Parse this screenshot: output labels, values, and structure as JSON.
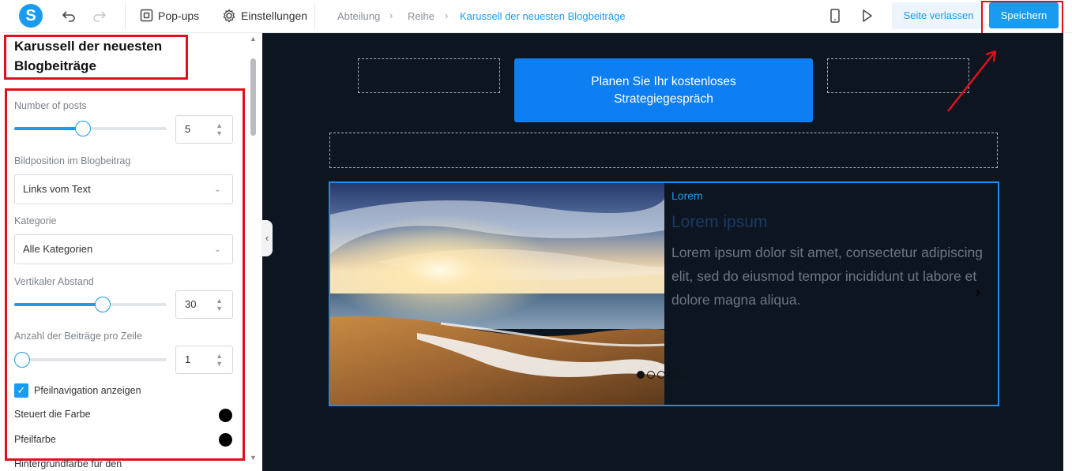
{
  "topbar": {
    "logo_letter": "S",
    "popups_label": "Pop-ups",
    "settings_label": "Einstellungen",
    "breadcrumb": [
      "Abteilung",
      "Reihe",
      "Karussell der neuesten Blogbeiträge"
    ],
    "leave_label": "Seite verlassen",
    "save_label": "Speichern"
  },
  "panel": {
    "title": "Karussell der neuesten Blogbeiträge",
    "number_of_posts": {
      "label": "Number of posts",
      "value": "5",
      "slider_fraction": 0.45
    },
    "image_position": {
      "label": "Bildposition im Blogbeitrag",
      "value": "Links vom Text"
    },
    "category": {
      "label": "Kategorie",
      "value": "Alle Kategorien"
    },
    "vertical_spacing": {
      "label": "Vertikaler Abstand",
      "value": "30",
      "slider_fraction": 0.58
    },
    "posts_per_row": {
      "label": "Anzahl der Beiträge pro Zeile",
      "value": "1",
      "slider_fraction": 0.0
    },
    "show_arrows": {
      "label": "Pfeilnavigation anzeigen",
      "checked": true
    },
    "controls_color": {
      "label": "Steuert die Farbe",
      "color": "#000000"
    },
    "arrow_color": {
      "label": "Pfeilfarbe",
      "color": "#000000"
    },
    "next_label": "Hintergrundfarbe für den"
  },
  "canvas": {
    "cta_label": "Planen Sie Ihr kostenloses Strategiegespräch",
    "post": {
      "category": "Lorem",
      "title": "Lorem ipsum",
      "excerpt": "Lorem ipsum dolor sit amet, consectetur adipiscing elit, sed do eiusmod tempor incididunt ut labore et dolore magna aliqua."
    },
    "carousel_dots": 5,
    "active_dot": 0
  },
  "colors": {
    "accent": "#1a9bf0",
    "canvas_bg": "#0d1520",
    "highlight": "#e0101a"
  }
}
